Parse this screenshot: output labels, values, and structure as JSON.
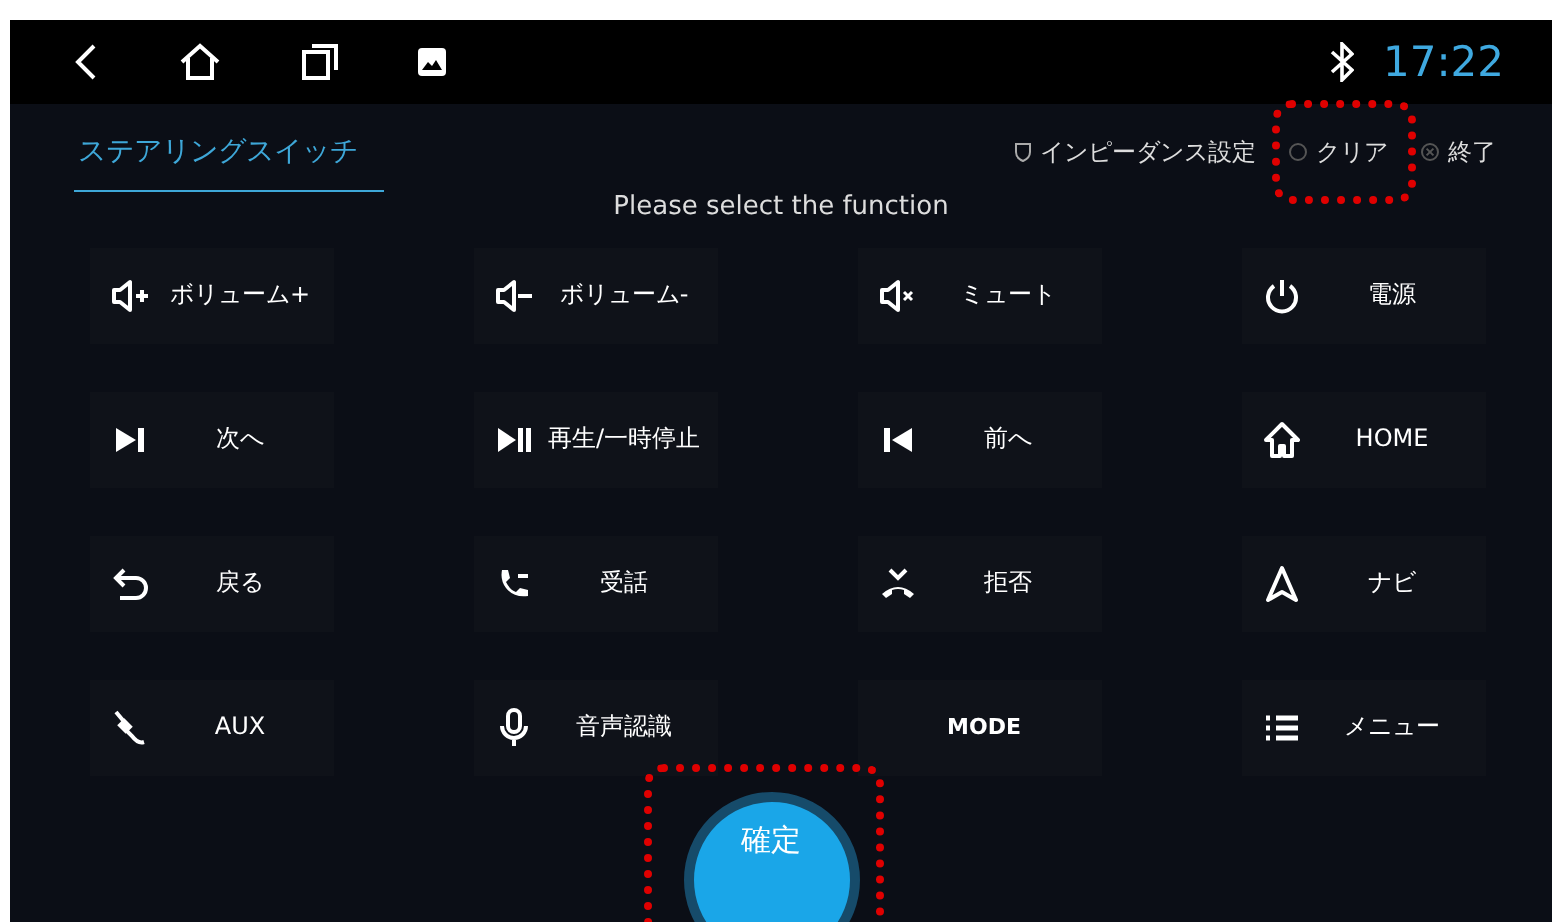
{
  "status_bar": {
    "time": "17:22"
  },
  "tabs": [
    {
      "label": "ステアリングスイッチ",
      "selected": true
    }
  ],
  "header_actions": [
    "インピーダンス設定",
    "クリア",
    "終了"
  ],
  "prompt": "Please select the function",
  "functions": [
    {
      "label": "ボリューム+"
    },
    {
      "label": "ボリューム-"
    },
    {
      "label": "ミュート"
    },
    {
      "label": "電源"
    },
    {
      "label": "次へ"
    },
    {
      "label": "再生/一時停止"
    },
    {
      "label": "前へ"
    },
    {
      "label": "HOME"
    },
    {
      "label": "戻る"
    },
    {
      "label": "受話"
    },
    {
      "label": "拒否"
    },
    {
      "label": "ナビ"
    },
    {
      "label": "AUX"
    },
    {
      "label": "音声認識"
    },
    {
      "label": "MODE"
    },
    {
      "label": "メニュー"
    }
  ],
  "confirm_button": "確定"
}
